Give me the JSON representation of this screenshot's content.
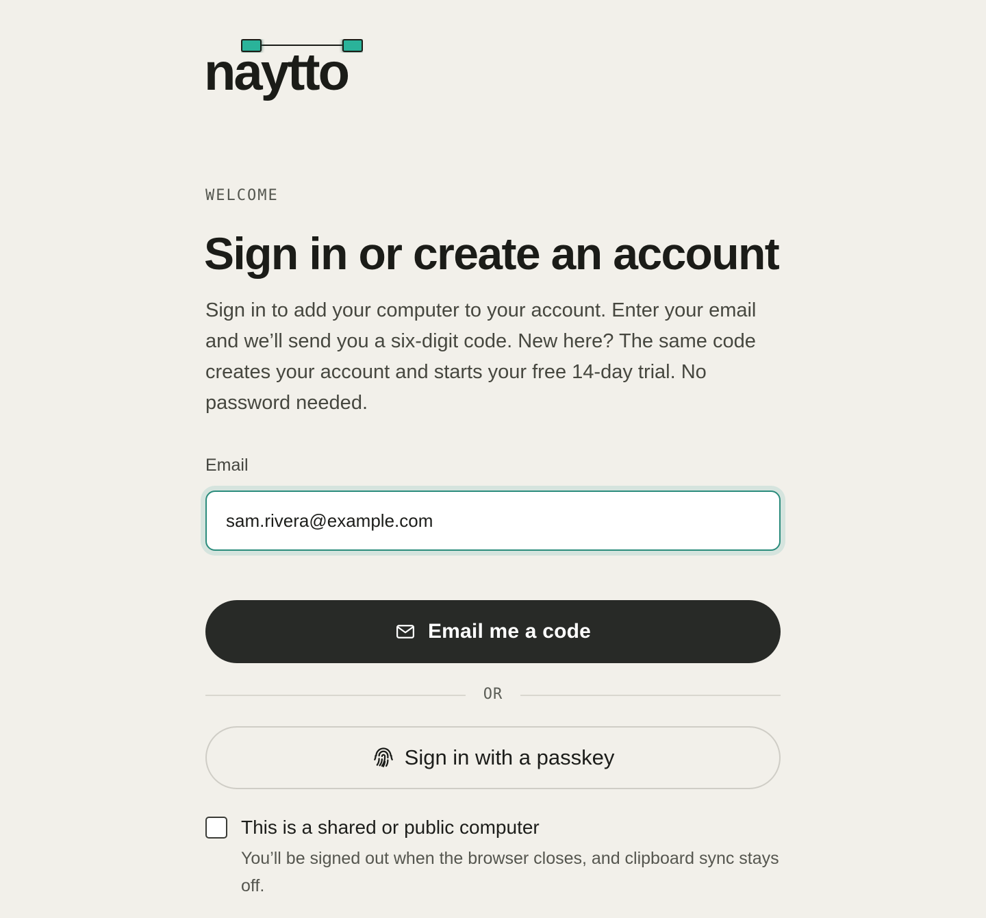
{
  "brand": {
    "wordmark": "naytto",
    "accent_color": "#2bb39a",
    "mark_icon": "connected-nodes-icon"
  },
  "header": {
    "eyebrow": "WELCOME",
    "title": "Sign in or create an account",
    "description": "Sign in to add your computer to your account. Enter your email and we’ll send you a six-digit code. New here? The same code creates your account and starts your free 14-day trial. No password needed."
  },
  "form": {
    "email_label": "Email",
    "email_value": "sam.rivera@example.com",
    "focus_color": "#2b8c7c"
  },
  "actions": {
    "primary_label": "Email me a code",
    "primary_icon": "envelope-icon",
    "primary_color": "#282a27",
    "divider_text": "OR",
    "passkey_label": "Sign in with a passkey",
    "passkey_icon": "fingerprint-icon"
  },
  "shared_computer": {
    "checked": false,
    "label": "This is a shared or public computer",
    "hint": "You’ll be signed out when the browser closes, and clipboard sync stays off."
  }
}
